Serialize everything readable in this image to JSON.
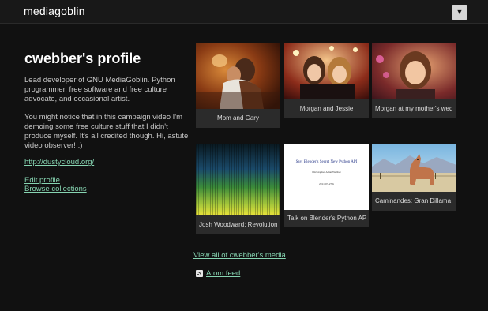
{
  "header": {
    "logo": "mediagoblin",
    "menu_glyph": "▼"
  },
  "profile": {
    "title": "cwebber's profile",
    "bio_1": "Lead developer of GNU MediaGoblin. Python programmer, free software and free culture advocate, and occasional artist.",
    "bio_2": "You might notice that in this campaign video I'm demoing some free culture stuff that I didn't produce myself. It's all credited though. Hi, astute video observer! :)",
    "website": "http://dustycloud.org/",
    "edit_label": "Edit profile",
    "browse_label": "Browse collections"
  },
  "media": [
    {
      "caption": "Mom and Gary"
    },
    {
      "caption": "Morgan and Jessie"
    },
    {
      "caption": "Morgan at my mother's wed"
    },
    {
      "caption": "Josh Woodward: Revolution"
    },
    {
      "caption": "Talk on Blender's Python AP"
    },
    {
      "caption": "Caminandes: Gran Dillama"
    }
  ],
  "slide": {
    "title": "Say: Blender's Secret New Python API",
    "author": "Christopher Allan Webber",
    "date": "2011-03-27th"
  },
  "view_all": "View all of cwebber's media",
  "atom_feed": "Atom feed",
  "colors": {
    "accent": "#86d4b1",
    "background": "#111111"
  }
}
